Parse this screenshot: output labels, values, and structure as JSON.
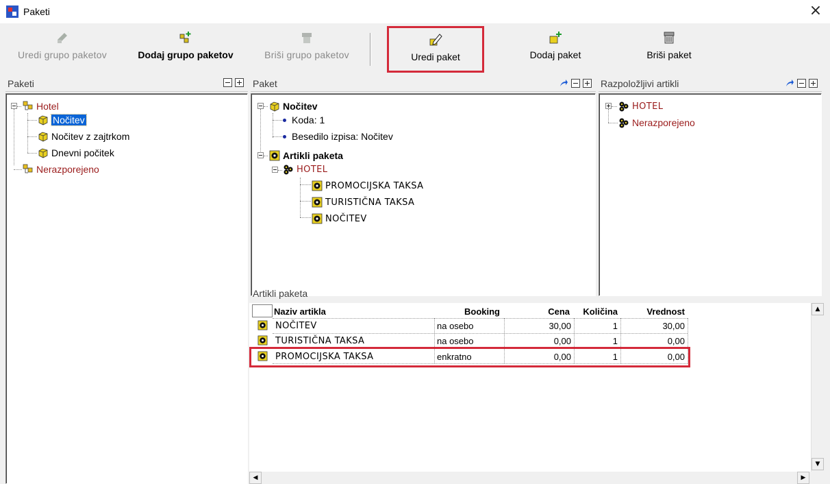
{
  "window": {
    "title": "Paketi"
  },
  "toolbar": {
    "edit_group": "Uredi grupo paketov",
    "add_group": "Dodaj grupo paketov",
    "delete_group": "Briši grupo paketov",
    "edit_package": "Uredi paket",
    "add_package": "Dodaj paket",
    "delete_package": "Briši paket"
  },
  "packages_panel": {
    "title": "Paketi",
    "tree": {
      "hotel": "Hotel",
      "items": [
        "Nočitev",
        "Nočitev z zajtrkom",
        "Dnevni počitek"
      ],
      "unassigned": "Nerazporejeno"
    }
  },
  "package_panel": {
    "title": "Paket",
    "name": "Nočitev",
    "code": "Koda: 1",
    "print_text": "Besedilo izpisa: Nočitev",
    "articles_label": "Artikli paketa",
    "group": "HOTEL",
    "articles": [
      "PROMOCIJSKA TAKSA",
      "TURISTIČNA TAKSA",
      "NOČITEV"
    ]
  },
  "available_panel": {
    "title": "Razpoložljivi artikli",
    "group": "HOTEL",
    "unassigned": "Nerazporejeno"
  },
  "articles_grid": {
    "title": "Artikli paketa",
    "columns": [
      "Naziv artikla",
      "Booking",
      "Cena",
      "Količina",
      "Vrednost"
    ],
    "rows": [
      {
        "name": "NOČITEV",
        "booking": "na osebo",
        "price": "30,00",
        "qty": "1",
        "value": "30,00"
      },
      {
        "name": "TURISTIČNA TAKSA",
        "booking": "na osebo",
        "price": "0,00",
        "qty": "1",
        "value": "0,00"
      },
      {
        "name": "PROMOCIJSKA TAKSA",
        "booking": "enkratno",
        "price": "0,00",
        "qty": "1",
        "value": "0,00"
      }
    ]
  },
  "colors": {
    "highlight": "#d42a3a",
    "selection": "#0a64d6",
    "tree_red": "#9a1b1b"
  }
}
